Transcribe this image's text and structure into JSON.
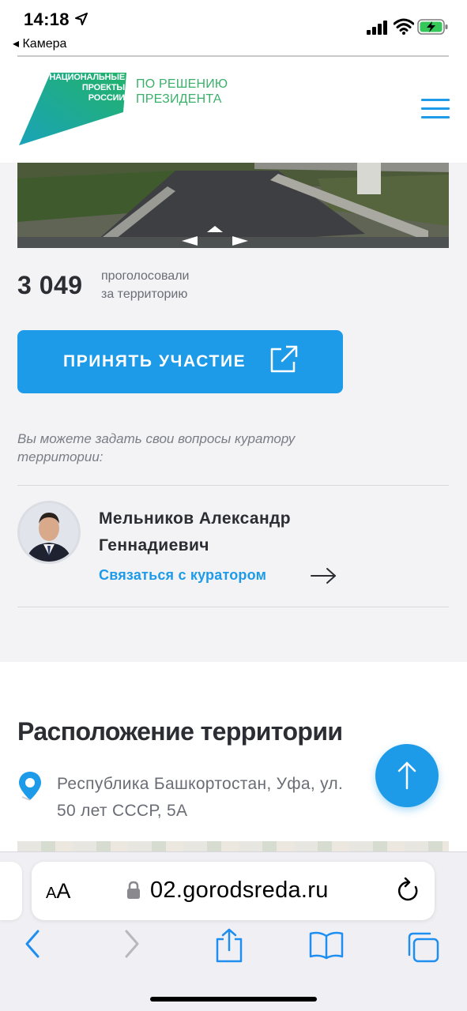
{
  "status_bar": {
    "time": "14:18",
    "back_app": "◂ Камера"
  },
  "header": {
    "logo_lines": [
      "НАЦИОНАЛЬНЫЕ",
      "ПРОЕКТЫ",
      "РОССИИ"
    ],
    "slogan_line1": "ПО РЕШЕНИЮ",
    "slogan_line2": "ПРЕЗИДЕНТА",
    "menu_icon": "hamburger-icon"
  },
  "photo": {
    "nav_icon": "panorama-arrows-icon"
  },
  "votes": {
    "count": "3 049",
    "label_line1": "проголосовали",
    "label_line2": "за территорию"
  },
  "participate": {
    "label": "ПРИНЯТЬ УЧАСТИЕ",
    "icon": "external-link-icon"
  },
  "curator": {
    "question_line1": "Вы можете задать свои вопросы куратору",
    "question_line2": "территории:",
    "name_line1": "Мельников Александр",
    "name_line2": "Геннадиевич",
    "contact_label": "Связаться с куратором"
  },
  "location": {
    "title": "Расположение территории",
    "address_line1": "Республика Башкортостан, Уфа, ул.",
    "address_line2": "50 лет СССР, 5А"
  },
  "safari": {
    "text_size": "AA",
    "url": "02.gorodsreda.ru"
  },
  "colors": {
    "accent_blue": "#1e9be8",
    "brand_green": "#3bb06a",
    "text_dark": "#2b2d33"
  }
}
